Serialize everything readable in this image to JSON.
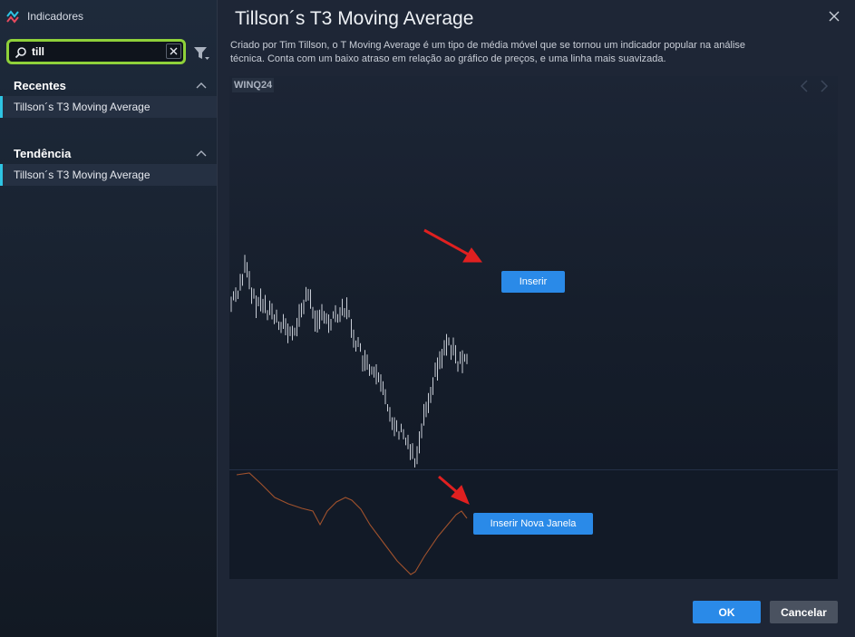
{
  "sidebar": {
    "title": "Indicadores",
    "search": {
      "value": "till",
      "placeholder": ""
    },
    "sections": [
      {
        "title": "Recentes",
        "items": [
          "Tillson´s T3 Moving Average"
        ]
      },
      {
        "title": "Tendência",
        "items": [
          "Tillson´s T3 Moving Average"
        ]
      }
    ]
  },
  "main": {
    "title": "Tillson´s T3 Moving Average",
    "description": "Criado por Tim Tillson, o T Moving Average é um tipo de média móvel que se tornou um indicador popular na análise técnica. Conta com um baixo atraso em relação ao gráfico de preços, e uma linha mais suavizada.",
    "preview": {
      "symbol": "WINQ24",
      "insert_label": "Inserir",
      "insert_new_window_label": "Inserir Nova Janela"
    }
  },
  "footer": {
    "ok_label": "OK",
    "cancel_label": "Cancelar"
  },
  "colors": {
    "accent": "#2a8ae8",
    "highlight_border": "#8fd13a",
    "selection_bar": "#2ec4e3",
    "indicator_line": "#a0522d",
    "arrow": "#e02020"
  }
}
